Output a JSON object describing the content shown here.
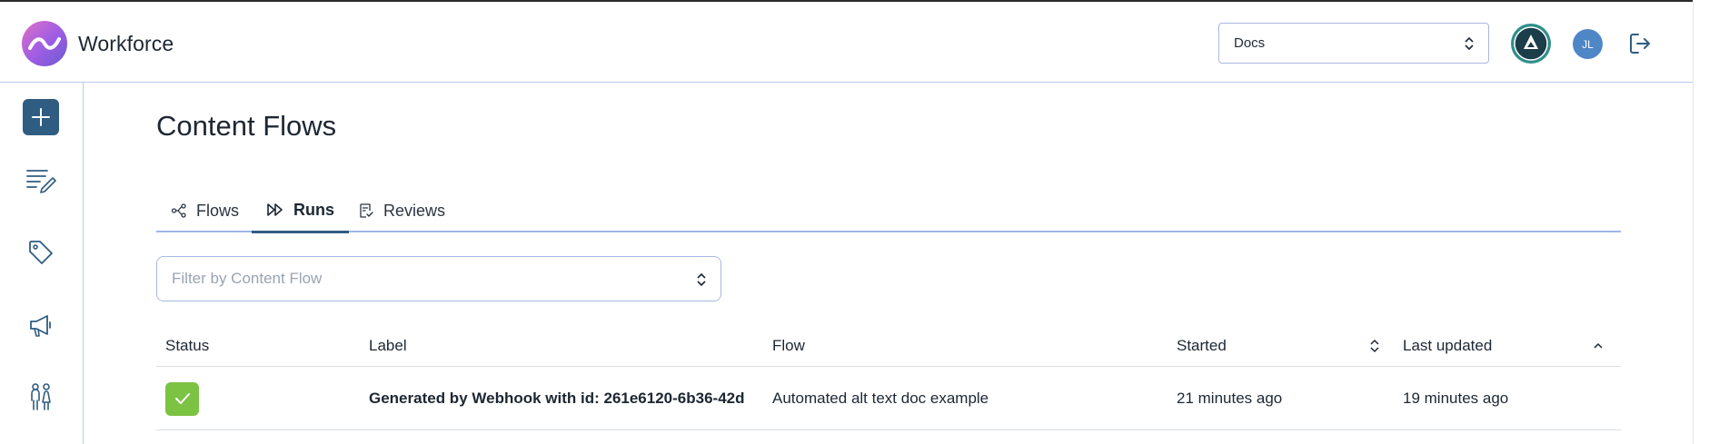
{
  "app": {
    "brand": "Workforce"
  },
  "header": {
    "workspace_select": {
      "value": "Docs"
    },
    "user_avatar": {
      "initials": "JL"
    }
  },
  "sidebar": {
    "items": [
      {
        "icon": "plus-icon"
      },
      {
        "icon": "text-edit-icon"
      },
      {
        "icon": "tag-icon"
      },
      {
        "icon": "megaphone-icon"
      },
      {
        "icon": "people-icon"
      }
    ]
  },
  "page": {
    "title": "Content Flows"
  },
  "tabs": [
    {
      "label": "Flows",
      "icon": "flows-icon"
    },
    {
      "label": "Runs",
      "icon": "fast-forward-icon",
      "active": true
    },
    {
      "label": "Reviews",
      "icon": "review-icon"
    }
  ],
  "filter": {
    "placeholder": "Filter by Content Flow"
  },
  "table": {
    "columns": [
      "Status",
      "Label",
      "Flow",
      "Started",
      "Last updated"
    ],
    "rows": [
      {
        "status": "success",
        "label": "Generated by Webhook with id: 261e6120-6b36-42d",
        "flow": "Automated alt text doc example",
        "started": "21 minutes ago",
        "last_updated": "19 minutes ago"
      }
    ]
  },
  "colors": {
    "accent": "#2f5d82",
    "border": "#b9c8ee",
    "success": "#7cc243",
    "avatar": "#4f86c6"
  }
}
